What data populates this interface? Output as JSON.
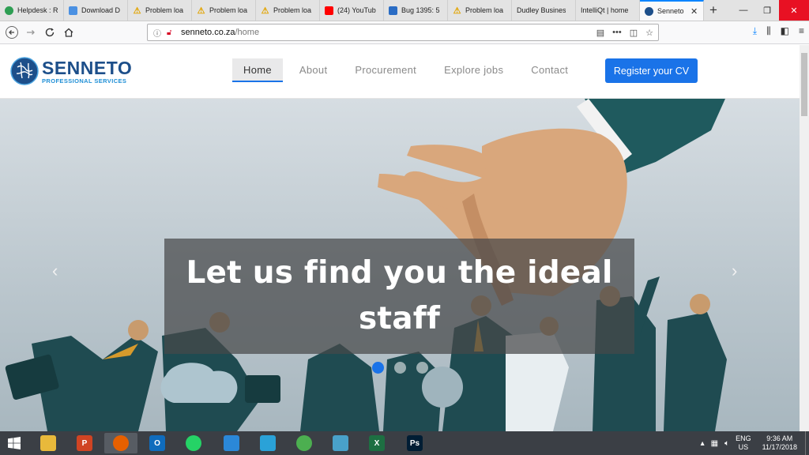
{
  "browser": {
    "tabs": [
      {
        "label": "Helpdesk : R",
        "icon": "green-circle-icon",
        "color": "#2e9e53"
      },
      {
        "label": "Download D",
        "icon": "d-letter-icon",
        "color": "#4a90e2"
      },
      {
        "label": "Problem loa",
        "icon": "warning-icon",
        "color": "#e2a400"
      },
      {
        "label": "Problem loa",
        "icon": "warning-icon",
        "color": "#e2a400"
      },
      {
        "label": "Problem loa",
        "icon": "warning-icon",
        "color": "#e2a400"
      },
      {
        "label": "(24) YouTub",
        "icon": "youtube-icon",
        "color": "#ff0000"
      },
      {
        "label": "Bug 1395: 5",
        "icon": "bug-icon",
        "color": "#2a6cc4"
      },
      {
        "label": "Problem loa",
        "icon": "warning-icon",
        "color": "#e2a400"
      },
      {
        "label": "Dudley Business",
        "icon": "",
        "color": ""
      },
      {
        "label": "IntelliQt | home",
        "icon": "",
        "color": ""
      }
    ],
    "active_tab": {
      "label": "Senneto",
      "icon": "senneto-logo-icon"
    },
    "url_host": "senneto.co.za",
    "url_path": "/home"
  },
  "site": {
    "logo_name": "SENNETO",
    "logo_sub": "PROFESSIONAL SERVICES",
    "nav": [
      "Home",
      "About",
      "Procurement",
      "Explore jobs",
      "Contact"
    ],
    "cta": "Register your CV"
  },
  "hero": {
    "caption": "Let us find you the ideal staff",
    "slides": 3,
    "active_slide": 1
  },
  "taskbar": {
    "lang_1": "ENG",
    "lang_2": "US",
    "time": "9:36 AM",
    "date": "11/17/2018",
    "apps": [
      {
        "icon": "file-explorer-icon",
        "color": "#e8b93b",
        "glyph": ""
      },
      {
        "icon": "powerpoint-icon",
        "color": "#d04423",
        "glyph": "P"
      },
      {
        "icon": "firefox-icon",
        "color": "#e66000",
        "glyph": ""
      },
      {
        "icon": "outlook-icon",
        "color": "#0f6cbd",
        "glyph": "O"
      },
      {
        "icon": "whatsapp-icon",
        "color": "#25d366",
        "glyph": ""
      },
      {
        "icon": "remote-desktop-icon",
        "color": "#2b88d8",
        "glyph": ""
      },
      {
        "icon": "send-icon",
        "color": "#2aa2d8",
        "glyph": ""
      },
      {
        "icon": "chrome-icon",
        "color": "#4caf50",
        "glyph": ""
      },
      {
        "icon": "notes-icon",
        "color": "#49a1c9",
        "glyph": ""
      },
      {
        "icon": "excel-icon",
        "color": "#1d6f42",
        "glyph": "X"
      },
      {
        "icon": "photoshop-icon",
        "color": "#001d34",
        "glyph": "Ps"
      }
    ]
  }
}
